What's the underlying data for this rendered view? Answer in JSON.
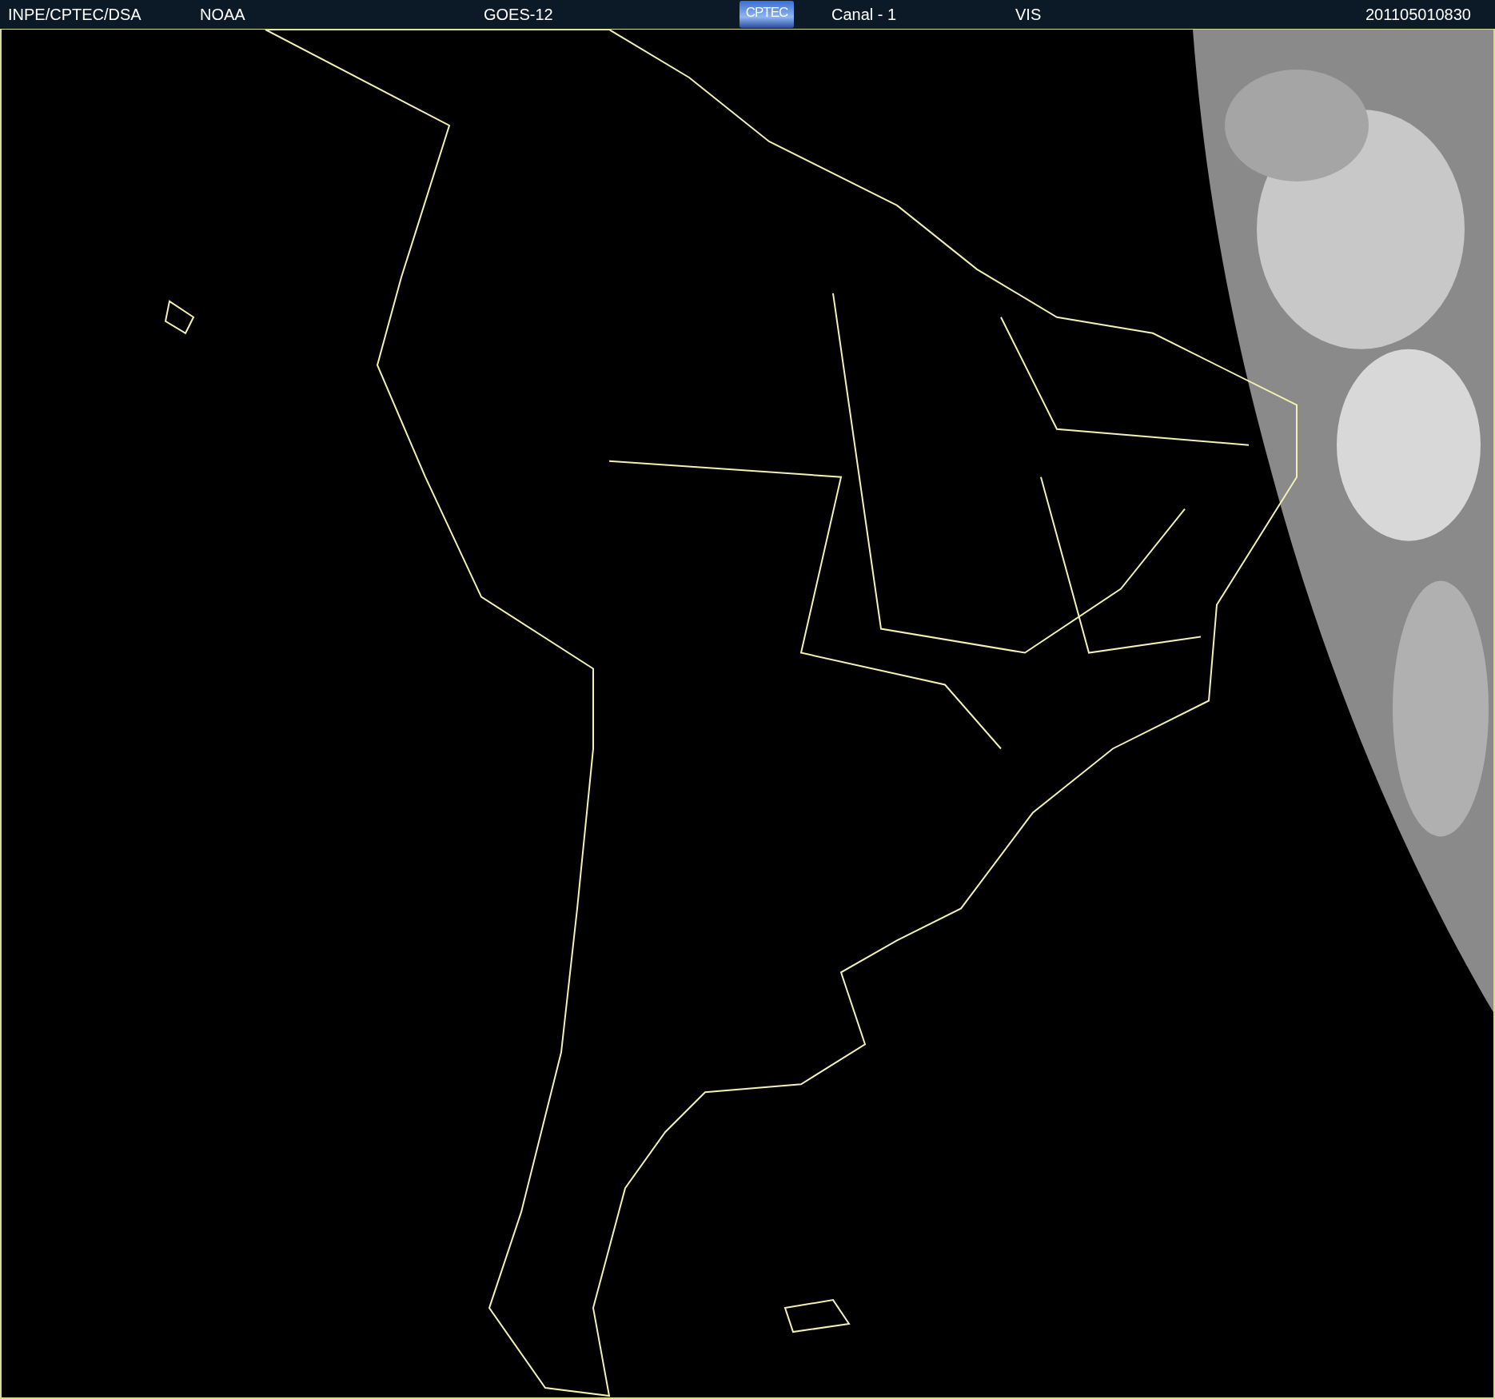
{
  "header": {
    "items": [
      {
        "kind": "text",
        "text": "INPE/CPTEC/DSA"
      },
      {
        "kind": "text",
        "text": "NOAA"
      },
      {
        "kind": "text",
        "text": "GOES-12"
      },
      {
        "kind": "logo",
        "text": "CPTEC"
      },
      {
        "kind": "text",
        "text": "Canal - 1"
      },
      {
        "kind": "text",
        "text": "VIS"
      },
      {
        "kind": "text",
        "text": "201105010830"
      }
    ]
  }
}
